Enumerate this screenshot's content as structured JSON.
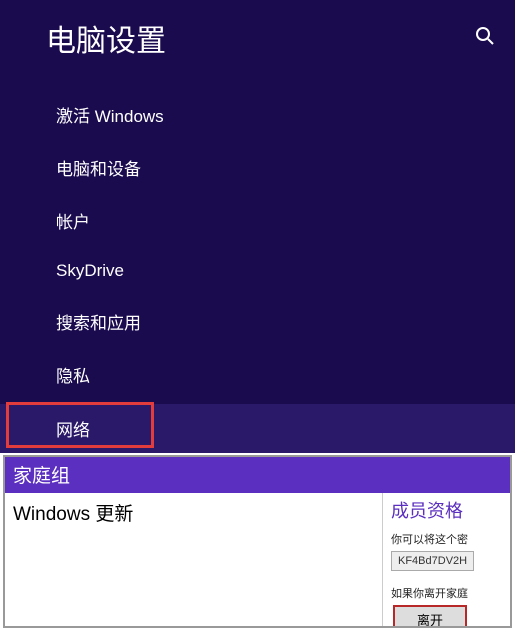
{
  "header": {
    "title": "电脑设置"
  },
  "menu": {
    "items": [
      {
        "label": "激活 Windows"
      },
      {
        "label": "电脑和设备"
      },
      {
        "label": "帐户"
      },
      {
        "label": "SkyDrive"
      },
      {
        "label": "搜索和应用"
      },
      {
        "label": "隐私"
      },
      {
        "label": "网络"
      }
    ]
  },
  "bottom": {
    "header": "家庭组",
    "left_item": "Windows 更新",
    "right": {
      "title": "成员资格",
      "text1": "你可以将这个密",
      "code": "KF4Bd7DV2H",
      "text2": "如果你离开家庭",
      "leave_label": "离开"
    }
  }
}
